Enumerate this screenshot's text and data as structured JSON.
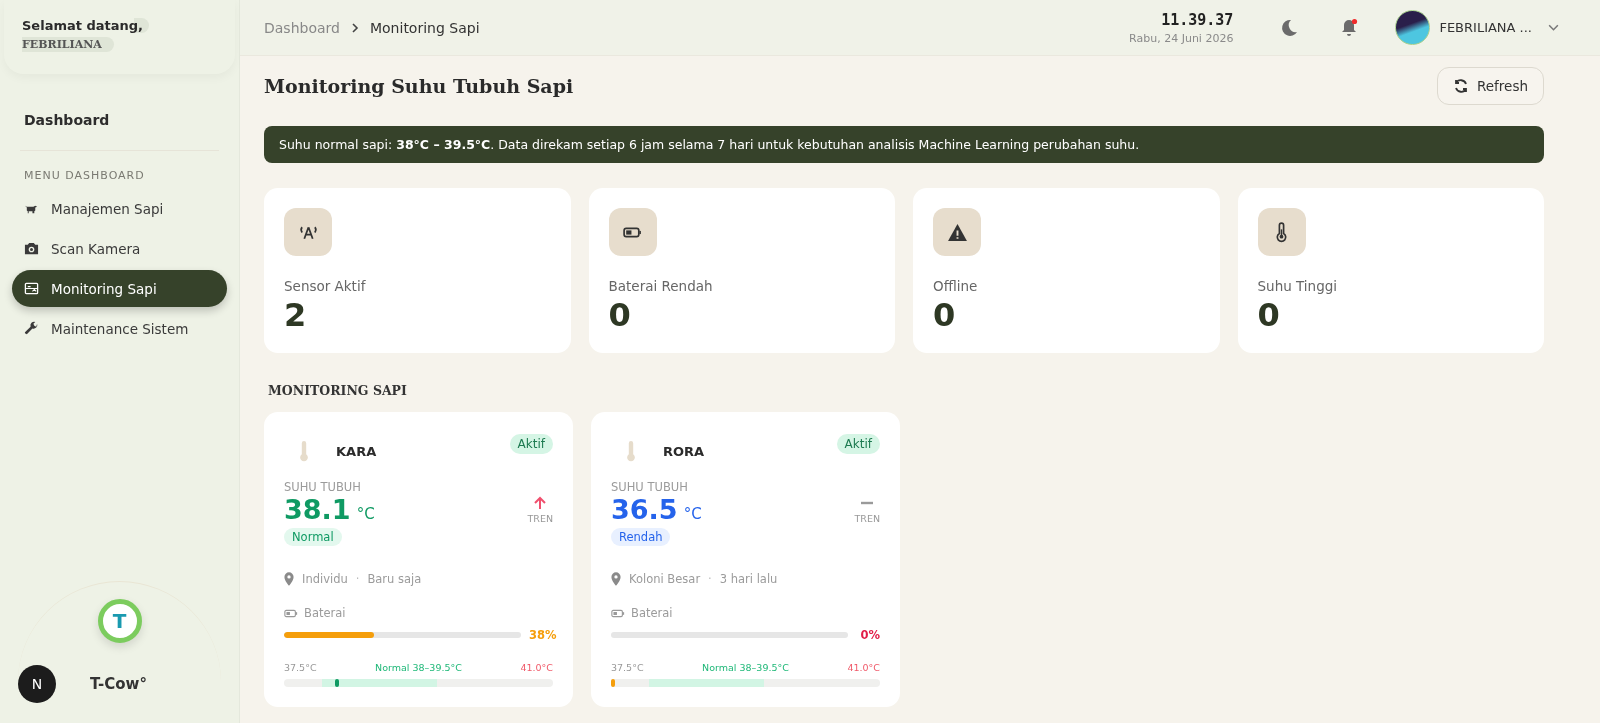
{
  "sidebar": {
    "greeting": "Selamat datang,",
    "user": "FEBRILIANA",
    "home": "Dashboard",
    "section": "MENU DASHBOARD",
    "items": [
      {
        "label": "Manajemen Sapi",
        "kind": "cow",
        "selected": false
      },
      {
        "label": "Scan Kamera",
        "kind": "camera",
        "selected": false
      },
      {
        "label": "Monitoring Sapi",
        "kind": "monitor",
        "selected": true
      },
      {
        "label": "Maintenance Sistem",
        "kind": "wrench",
        "selected": false
      }
    ],
    "logo_letter": "T",
    "brand": "T-Cow°",
    "dev_badge": "N"
  },
  "header": {
    "breadcrumb": [
      "Dashboard",
      "Monitoring Sapi"
    ],
    "time": "11.39.37",
    "date": "Rabu, 24 Juni 2026",
    "notification_dot": true,
    "user": "FEBRILIANA ..."
  },
  "page": {
    "title": "Monitoring Suhu Tubuh Sapi",
    "refresh": "Refresh",
    "banner": "Suhu normal sapi: **38°C – 39.5°C**. Data direkam setiap 6 jam selama 7 hari untuk kebutuhan analisis Machine Learning perubahan suhu.",
    "stats": [
      {
        "kind": "sensor",
        "label": "Sensor Aktif",
        "value": "2"
      },
      {
        "kind": "battery",
        "label": "Baterai Rendah",
        "value": "0"
      },
      {
        "kind": "warning",
        "label": "Offline",
        "value": "0"
      },
      {
        "kind": "thermometer",
        "label": "Suhu Tinggi",
        "value": "0"
      }
    ],
    "section": "MONITORING SAPI",
    "cows": [
      {
        "name": "KARA",
        "status": "Aktif",
        "temp_label": "SUHU TUBUH",
        "temp": "38.1",
        "unit": "°C",
        "condition": {
          "text": "Normal",
          "kind": "normal"
        },
        "trend": {
          "kind": "up",
          "label": "TREN"
        },
        "location": "Individu",
        "separator": "·",
        "time": "Baru saja",
        "battery_label": "Baterai",
        "battery": {
          "level": 0.38
        },
        "battery_text": "38%",
        "scale_min": "37.5°C",
        "scale_normal": "Normal 38–39.5°C",
        "scale_max": "41.0°C",
        "temp_level": {
          "level": 0.19
        }
      },
      {
        "name": "RORA",
        "status": "Aktif",
        "temp_label": "SUHU TUBUH",
        "temp": "36.5",
        "unit": "°C",
        "condition": {
          "text": "Rendah",
          "kind": "low"
        },
        "trend": {
          "kind": "flat",
          "label": "TREN"
        },
        "location": "Koloni Besar",
        "separator": "·",
        "time": "3 hari lalu",
        "battery_label": "Baterai",
        "battery": {
          "level": 0
        },
        "battery_text": "0%",
        "scale_min": "37.5°C",
        "scale_normal": "Normal 38–39.5°C",
        "scale_max": "41.0°C",
        "temp_level": {
          "level": 0
        }
      }
    ]
  }
}
